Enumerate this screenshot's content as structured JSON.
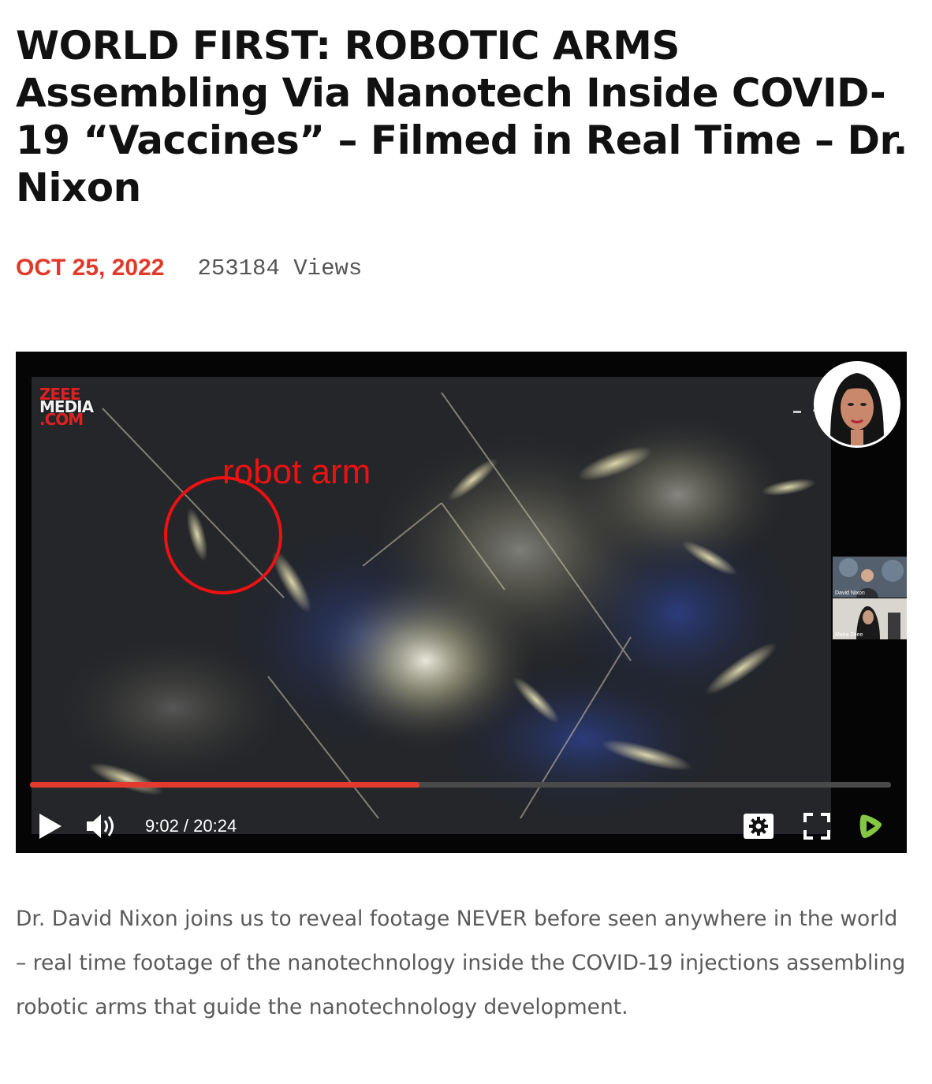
{
  "article": {
    "title": "WORLD FIRST: ROBOTIC ARMS Assembling Via Nanotech Inside COVID-19 “Vaccines” – Filmed in Real Time – Dr. Nixon",
    "date": "OCT 25, 2022",
    "views": "253184 Views",
    "description": "Dr. David Nixon joins us to reveal footage NEVER before seen anywhere in the world – real time footage of the nanotechnology inside the COVID-19 injections assembling robotic arms that guide the nanotechnology development."
  },
  "video": {
    "logo": {
      "line1": "ZEEE",
      "line2": "MEDIA",
      "line3": ".COM"
    },
    "annotation": "robot arm",
    "participants": [
      "David Nixon",
      "Maria Zeee"
    ],
    "current_time": "9:02",
    "duration": "20:24",
    "time_display": "9:02 / 20:24",
    "progress": 0.452
  },
  "controls": {
    "play_icon": "play-icon",
    "volume_icon": "volume-icon",
    "settings_icon": "gear-icon",
    "fullscreen_icon": "fullscreen-icon",
    "rumble_icon": "rumble-logo-icon"
  },
  "colors": {
    "accent_red": "#e03a2b",
    "progress_red": "#e43a2e",
    "rumble_green": "#85c742",
    "annotation_red": "#ee1111"
  }
}
